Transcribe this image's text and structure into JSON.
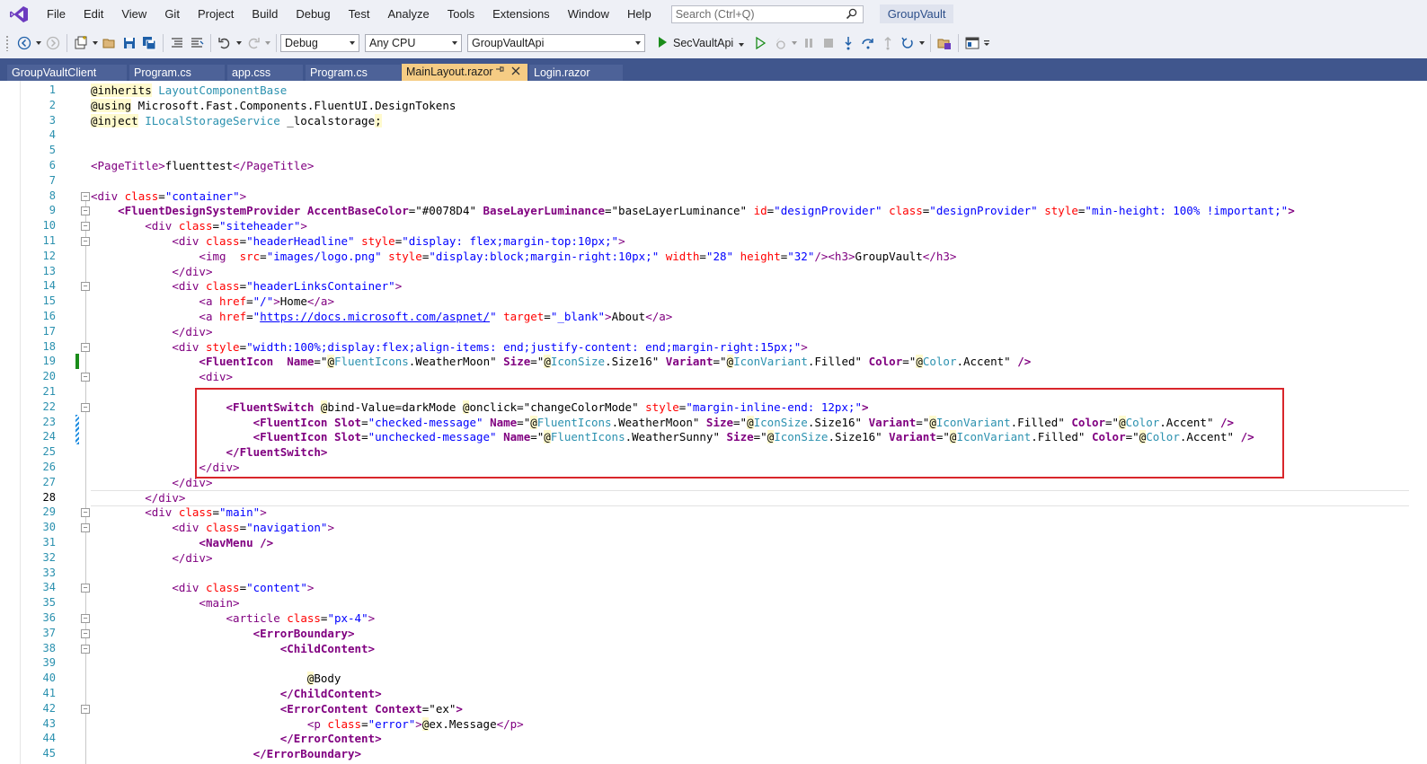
{
  "menubar": {
    "items": [
      "File",
      "Edit",
      "View",
      "Git",
      "Project",
      "Build",
      "Debug",
      "Test",
      "Analyze",
      "Tools",
      "Extensions",
      "Window",
      "Help"
    ],
    "search_placeholder": "Search (Ctrl+Q)",
    "solution_name": "GroupVault"
  },
  "toolbar": {
    "config": "Debug",
    "platform": "Any CPU",
    "startup_project": "GroupVaultApi",
    "run_target": "SecVaultApi"
  },
  "tabs": [
    {
      "label": "GroupVaultClient",
      "active": false
    },
    {
      "label": "Program.cs",
      "active": false
    },
    {
      "label": "app.css",
      "active": false
    },
    {
      "label": "Program.cs",
      "active": false
    },
    {
      "label": "MainLayout.razor",
      "active": true
    },
    {
      "label": "Login.razor",
      "active": false
    }
  ],
  "editor": {
    "current_line": 28,
    "lines": [
      {
        "n": "1",
        "html": "<span class='t-dir'>@inherits</span> <span class='t-type'>LayoutComponentBase</span>"
      },
      {
        "n": "2",
        "html": "<span class='t-dir'>@using</span> Microsoft.Fast.Components.FluentUI.DesignTokens"
      },
      {
        "n": "3",
        "html": "<span class='t-dir'>@inject</span> <span class='t-type'>ILocalStorageService</span> _localstorage<span class='t-dir'>;</span>"
      },
      {
        "n": "4",
        "html": ""
      },
      {
        "n": "5",
        "html": ""
      },
      {
        "n": "6",
        "html": "<span class='t-tag'>&lt;PageTitle&gt;</span>fluenttest<span class='t-tag'>&lt;/PageTitle&gt;</span>"
      },
      {
        "n": "7",
        "html": ""
      },
      {
        "n": "8",
        "html": "<span class='t-tag'>&lt;div</span> <span class='t-attr'>class</span>=<span class='t-str'>\"container\"</span><span class='t-tag'>&gt;</span>"
      },
      {
        "n": "9",
        "html": "    <span class='t-comp'>&lt;FluentDesignSystemProvider</span> <span class='t-cattr'>AccentBaseColor</span>=\"#0078D4\" <span class='t-cattr'>BaseLayerLuminance</span>=\"baseLayerLuminance\" <span class='t-attr'>id</span>=<span class='t-str'>\"designProvider\"</span> <span class='t-attr'>class</span>=<span class='t-str'>\"designProvider\"</span> <span class='t-attr'>style</span>=<span class='t-str'>\"min-height: 100% !important;\"</span><span class='t-comp'>&gt;</span>"
      },
      {
        "n": "10",
        "html": "        <span class='t-tag'>&lt;div</span> <span class='t-attr'>class</span>=<span class='t-str'>\"siteheader\"</span><span class='t-tag'>&gt;</span>"
      },
      {
        "n": "11",
        "html": "            <span class='t-tag'>&lt;div</span> <span class='t-attr'>class</span>=<span class='t-str'>\"headerHeadline\"</span> <span class='t-attr'>style</span>=<span class='t-str'>\"display: flex;margin-top:10px;\"</span><span class='t-tag'>&gt;</span>"
      },
      {
        "n": "12",
        "html": "                <span class='t-tag'>&lt;img</span>  <span class='t-attr'>src</span>=<span class='t-str'>\"images/logo.png\"</span> <span class='t-attr'>style</span>=<span class='t-str'>\"display:block;margin-right:10px;\"</span> <span class='t-attr'>width</span>=<span class='t-str'>\"28\"</span> <span class='t-attr'>height</span>=<span class='t-str'>\"32\"</span><span class='t-tag'>/&gt;&lt;h3&gt;</span>GroupVault<span class='t-tag'>&lt;/h3&gt;</span>"
      },
      {
        "n": "13",
        "html": "            <span class='t-tag'>&lt;/div&gt;</span>"
      },
      {
        "n": "14",
        "html": "            <span class='t-tag'>&lt;div</span> <span class='t-attr'>class</span>=<span class='t-str'>\"headerLinksContainer\"</span><span class='t-tag'>&gt;</span>"
      },
      {
        "n": "15",
        "html": "                <span class='t-tag'>&lt;a</span> <span class='t-attr'>href</span>=<span class='t-str'>\"/\"</span><span class='t-tag'>&gt;</span>Home<span class='t-tag'>&lt;/a&gt;</span>"
      },
      {
        "n": "16",
        "html": "                <span class='t-tag'>&lt;a</span> <span class='t-attr'>href</span>=<span class='t-str'>\"<u>https://docs.microsoft.com/aspnet/</u>\"</span> <span class='t-attr'>target</span>=<span class='t-str'>\"_blank\"</span><span class='t-tag'>&gt;</span>About<span class='t-tag'>&lt;/a&gt;</span>"
      },
      {
        "n": "17",
        "html": "            <span class='t-tag'>&lt;/div&gt;</span>"
      },
      {
        "n": "18",
        "html": "            <span class='t-tag'>&lt;div</span> <span class='t-attr'>style</span>=<span class='t-str'>\"width:100%;display:flex;align-items: end;justify-content: end;margin-right:15px;\"</span><span class='t-tag'>&gt;</span>"
      },
      {
        "n": "19",
        "html": "                <span class='t-comp'>&lt;FluentIcon</span>  <span class='t-cattr'>Name</span>=\"<span class='t-dir'>@</span><span class='t-type'>FluentIcons</span>.WeatherMoon\" <span class='t-cattr'>Size</span>=\"<span class='t-dir'>@</span><span class='t-type'>IconSize</span>.Size16\" <span class='t-cattr'>Variant</span>=\"<span class='t-dir'>@</span><span class='t-type'>IconVariant</span>.Filled\" <span class='t-cattr'>Color</span>=\"<span class='t-dir'>@</span><span class='t-type'>Color</span>.Accent\" <span class='t-comp'>/&gt;</span>"
      },
      {
        "n": "20",
        "html": "                <span class='t-tag'>&lt;div&gt;</span>"
      },
      {
        "n": "21",
        "html": ""
      },
      {
        "n": "22",
        "html": "                    <span class='t-comp'>&lt;FluentSwitch</span> <span class='t-dir'>@</span>bind-Value=darkMode <span class='t-dir'>@</span>onclick=\"changeColorMode\" <span class='t-attr'>style</span>=<span class='t-str'>\"margin-inline-end: 12px;\"</span><span class='t-comp'>&gt;</span>"
      },
      {
        "n": "23",
        "html": "                        <span class='t-comp'>&lt;FluentIcon</span> <span class='t-cattr'>Slot</span>=<span class='t-str'>\"checked-message\"</span> <span class='t-cattr'>Name</span>=\"<span class='t-dir'>@</span><span class='t-type'>FluentIcons</span>.WeatherMoon\" <span class='t-cattr'>Size</span>=\"<span class='t-dir'>@</span><span class='t-type'>IconSize</span>.Size16\" <span class='t-cattr'>Variant</span>=\"<span class='t-dir'>@</span><span class='t-type'>IconVariant</span>.Filled\" <span class='t-cattr'>Color</span>=\"<span class='t-dir'>@</span><span class='t-type'>Color</span>.Accent\" <span class='t-comp'>/&gt;</span>"
      },
      {
        "n": "24",
        "html": "                        <span class='t-comp'>&lt;FluentIcon</span> <span class='t-cattr'>Slot</span>=<span class='t-str'>\"unchecked-message\"</span> <span class='t-cattr'>Name</span>=\"<span class='t-dir'>@</span><span class='t-type'>FluentIcons</span>.WeatherSunny\" <span class='t-cattr'>Size</span>=\"<span class='t-dir'>@</span><span class='t-type'>IconSize</span>.Size16\" <span class='t-cattr'>Variant</span>=\"<span class='t-dir'>@</span><span class='t-type'>IconVariant</span>.Filled\" <span class='t-cattr'>Color</span>=\"<span class='t-dir'>@</span><span class='t-type'>Color</span>.Accent\" <span class='t-comp'>/&gt;</span>"
      },
      {
        "n": "25",
        "html": "                    <span class='t-comp'>&lt;/FluentSwitch&gt;</span>"
      },
      {
        "n": "26",
        "html": "                <span class='t-tag'>&lt;/div&gt;</span>"
      },
      {
        "n": "27",
        "html": "            <span class='t-tag'>&lt;/div&gt;</span>"
      },
      {
        "n": "28",
        "html": "        <span class='t-tag'>&lt;/div&gt;</span>"
      },
      {
        "n": "29",
        "html": "        <span class='t-tag'>&lt;div</span> <span class='t-attr'>class</span>=<span class='t-str'>\"main\"</span><span class='t-tag'>&gt;</span>"
      },
      {
        "n": "30",
        "html": "            <span class='t-tag'>&lt;div</span> <span class='t-attr'>class</span>=<span class='t-str'>\"navigation\"</span><span class='t-tag'>&gt;</span>"
      },
      {
        "n": "31",
        "html": "                <span class='t-comp'>&lt;NavMenu /&gt;</span>"
      },
      {
        "n": "32",
        "html": "            <span class='t-tag'>&lt;/div&gt;</span>"
      },
      {
        "n": "33",
        "html": ""
      },
      {
        "n": "34",
        "html": "            <span class='t-tag'>&lt;div</span> <span class='t-attr'>class</span>=<span class='t-str'>\"content\"</span><span class='t-tag'>&gt;</span>"
      },
      {
        "n": "35",
        "html": "                <span class='t-tag'>&lt;main&gt;</span>"
      },
      {
        "n": "36",
        "html": "                    <span class='t-tag'>&lt;article</span> <span class='t-attr'>class</span>=<span class='t-str'>\"px-4\"</span><span class='t-tag'>&gt;</span>"
      },
      {
        "n": "37",
        "html": "                        <span class='t-comp'>&lt;ErrorBoundary&gt;</span>"
      },
      {
        "n": "38",
        "html": "                            <span class='t-comp'>&lt;ChildContent&gt;</span>"
      },
      {
        "n": "39",
        "html": ""
      },
      {
        "n": "40",
        "html": "                                <span class='t-dir'>@</span>Body"
      },
      {
        "n": "41",
        "html": "                            <span class='t-comp'>&lt;/ChildContent&gt;</span>"
      },
      {
        "n": "42",
        "html": "                            <span class='t-comp'>&lt;ErrorContent</span> <span class='t-cattr'>Context</span>=\"ex\"<span class='t-comp'>&gt;</span>"
      },
      {
        "n": "43",
        "html": "                                <span class='t-tag'>&lt;p</span> <span class='t-attr'>class</span>=<span class='t-str'>\"error\"</span><span class='t-tag'>&gt;</span><span class='t-dir'>@</span>ex.Message<span class='t-tag'>&lt;/p&gt;</span>"
      },
      {
        "n": "44",
        "html": "                            <span class='t-comp'>&lt;/ErrorContent&gt;</span>"
      },
      {
        "n": "45",
        "html": "                        <span class='t-comp'>&lt;/ErrorBoundary&gt;</span>"
      }
    ]
  }
}
